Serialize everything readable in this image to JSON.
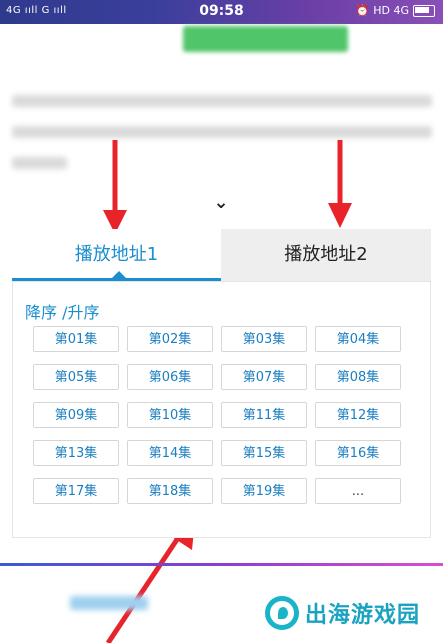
{
  "status_bar": {
    "left": "4G ııll G ııll",
    "time": "09:58",
    "right": "HD 4G"
  },
  "tabs": [
    {
      "label": "播放地址1",
      "active": true
    },
    {
      "label": "播放地址2",
      "active": false
    }
  ],
  "sort_label": "降序 /升序",
  "episodes": [
    "第01集",
    "第02集",
    "第03集",
    "第04集",
    "第05集",
    "第06集",
    "第07集",
    "第08集",
    "第09集",
    "第10集",
    "第11集",
    "第12集",
    "第13集",
    "第14集",
    "第15集",
    "第16集",
    "第17集",
    "第18集",
    "第19集",
    "..."
  ],
  "watermark": {
    "text": "出海游戏园"
  },
  "colors": {
    "accent": "#1a8fd0",
    "arrow": "#e8232a",
    "watermark": "#1aa3c0"
  }
}
